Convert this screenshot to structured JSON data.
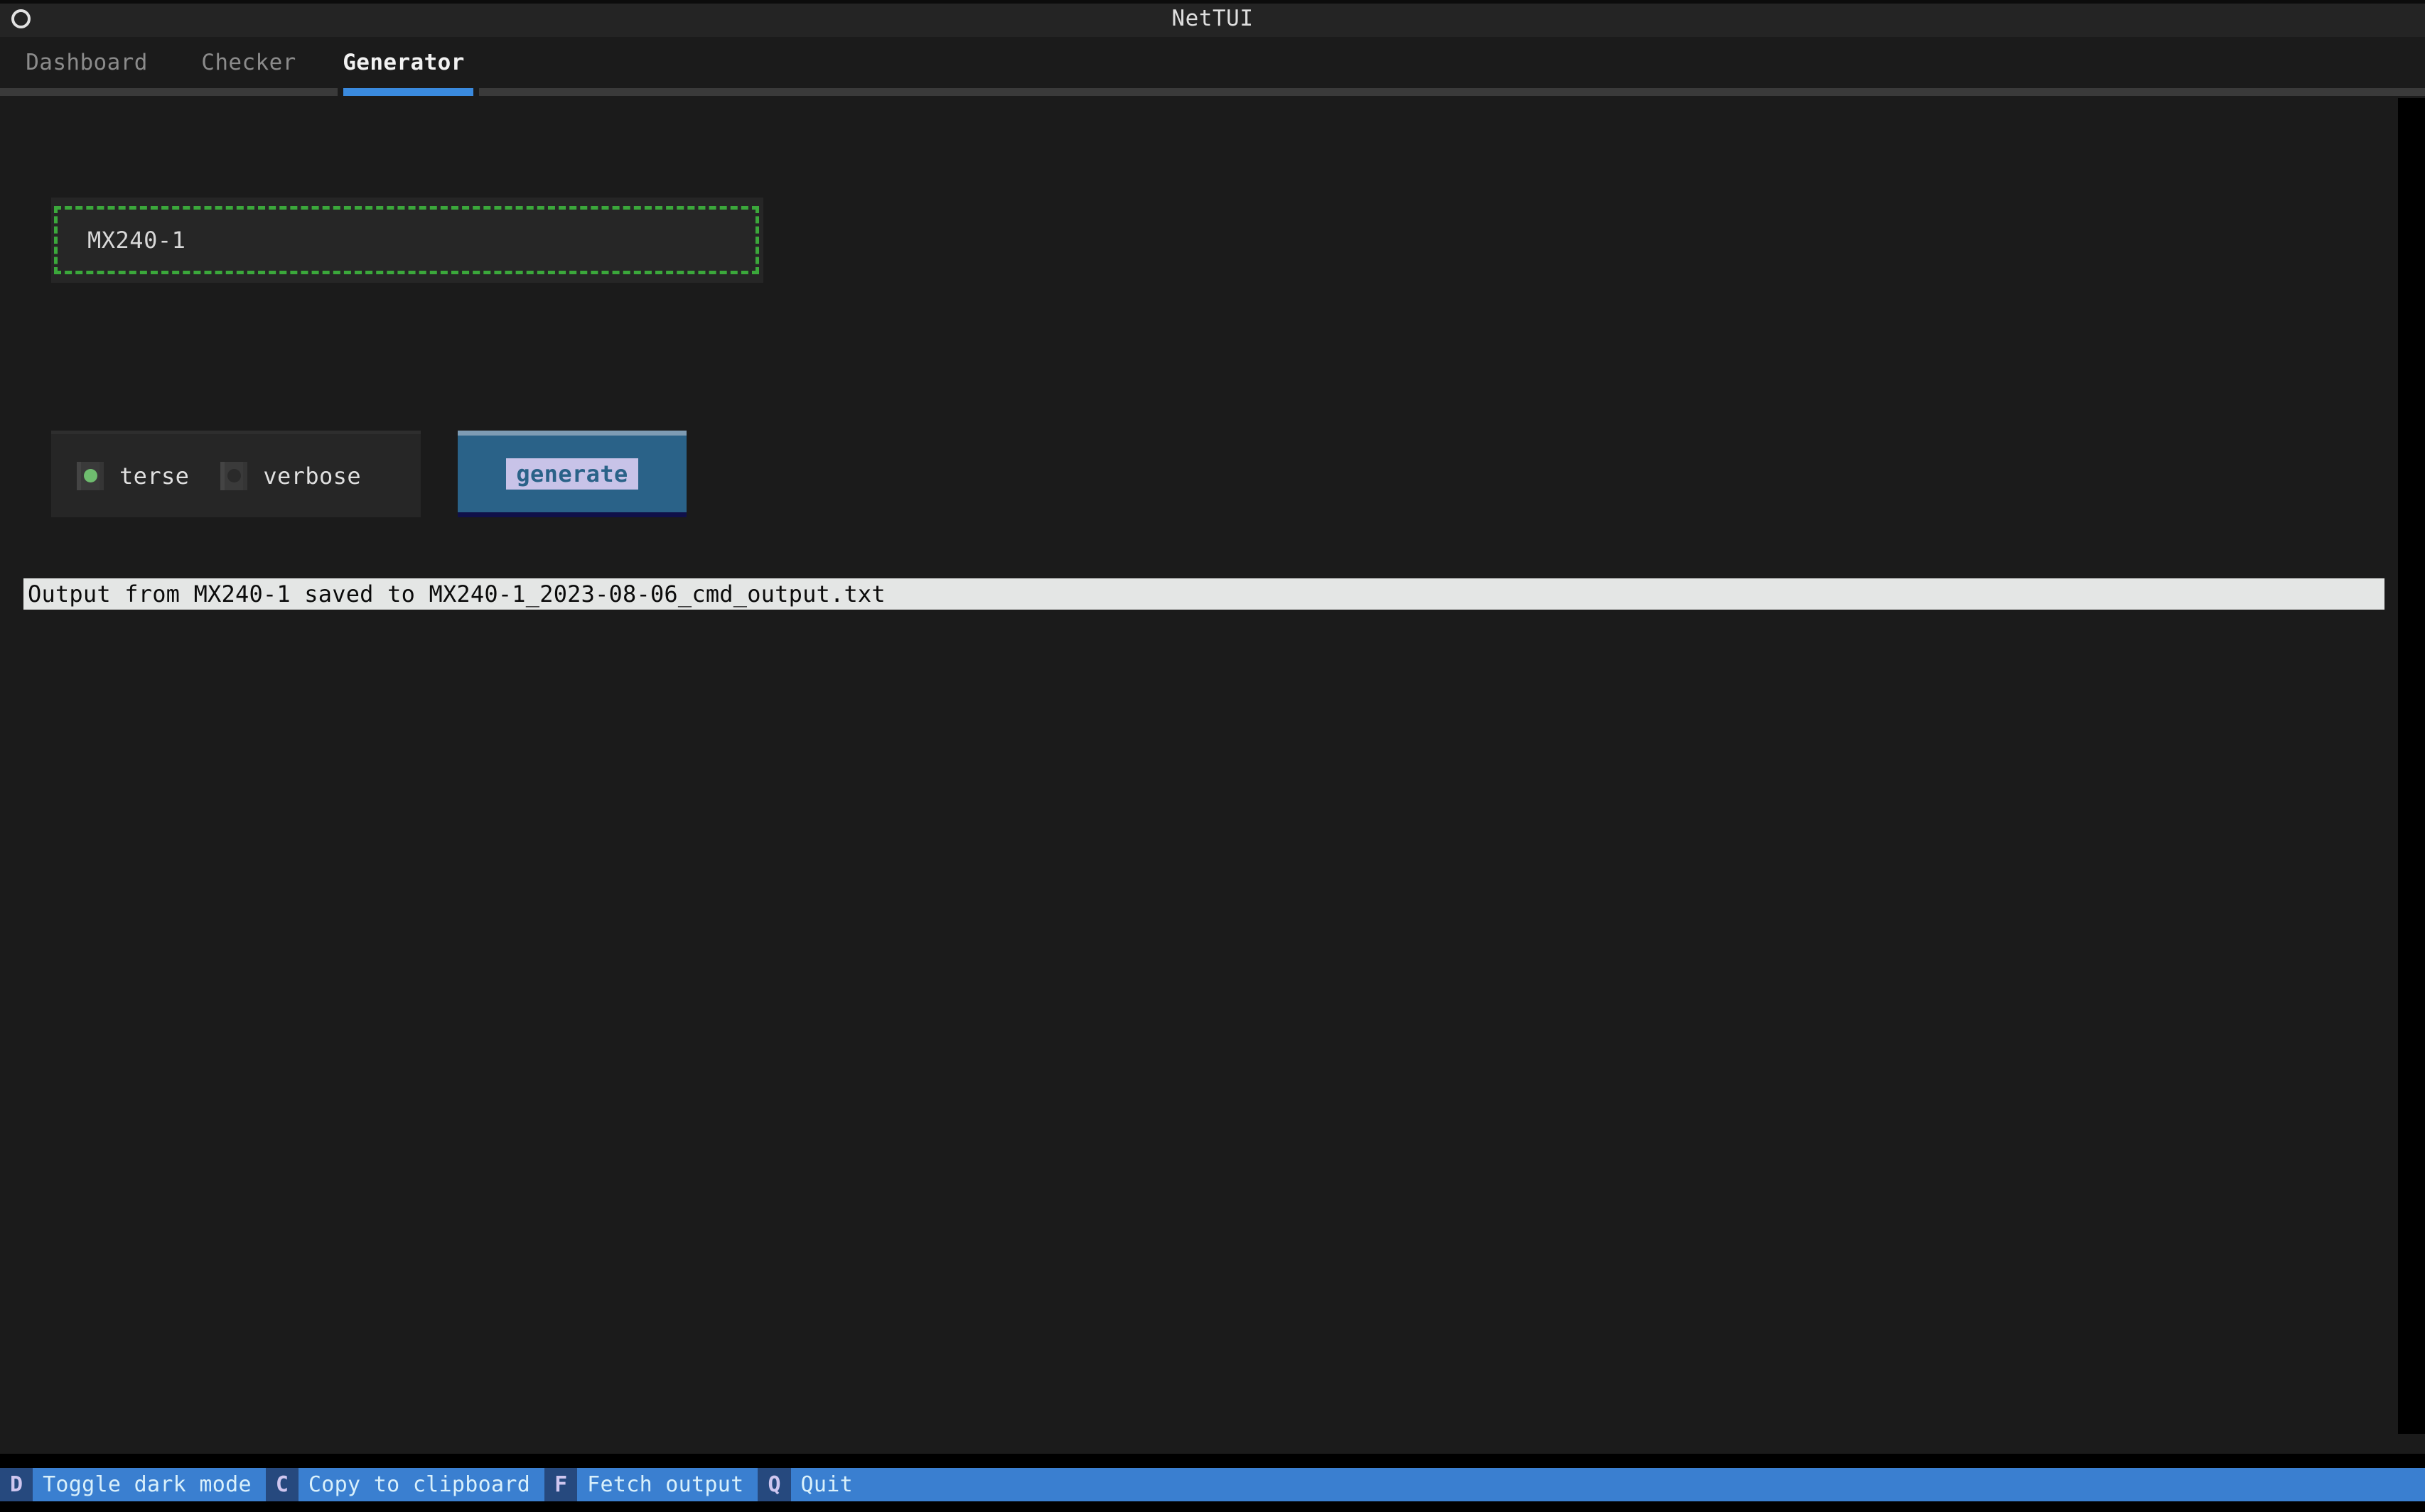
{
  "window": {
    "title": "NetTUI",
    "menu_icon": "circle-icon"
  },
  "tabs": [
    {
      "label": "Dashboard",
      "active": false
    },
    {
      "label": "Checker",
      "active": false
    },
    {
      "label": "Generator",
      "active": true
    }
  ],
  "generator": {
    "device_input": {
      "value": "MX240-1",
      "placeholder": "",
      "focused": true,
      "border_color": "#3ba83b"
    },
    "verbosity": {
      "options": [
        {
          "label": "terse",
          "selected": true
        },
        {
          "label": "verbose",
          "selected": false
        }
      ],
      "selected_dot_color": "#6fbd6f"
    },
    "generate_button": {
      "label": "generate",
      "bg": "#2a6288",
      "caption_bg": "#c8c3e8"
    },
    "output_message": "Output from MX240-1 saved to MX240-1_2023-08-06_cmd_output.txt"
  },
  "footer": {
    "bindings": [
      {
        "key": "D",
        "desc": "Toggle dark mode"
      },
      {
        "key": "C",
        "desc": "Copy to clipboard"
      },
      {
        "key": "F",
        "desc": "Fetch output"
      },
      {
        "key": "Q",
        "desc": "Quit"
      }
    ],
    "key_bg": "#26497e",
    "desc_bg": "#3a7fd0"
  },
  "theme": {
    "background": "#1b1b1b",
    "titlebar": "#242424",
    "accent": "#3a8ade",
    "panel": "#262626"
  }
}
